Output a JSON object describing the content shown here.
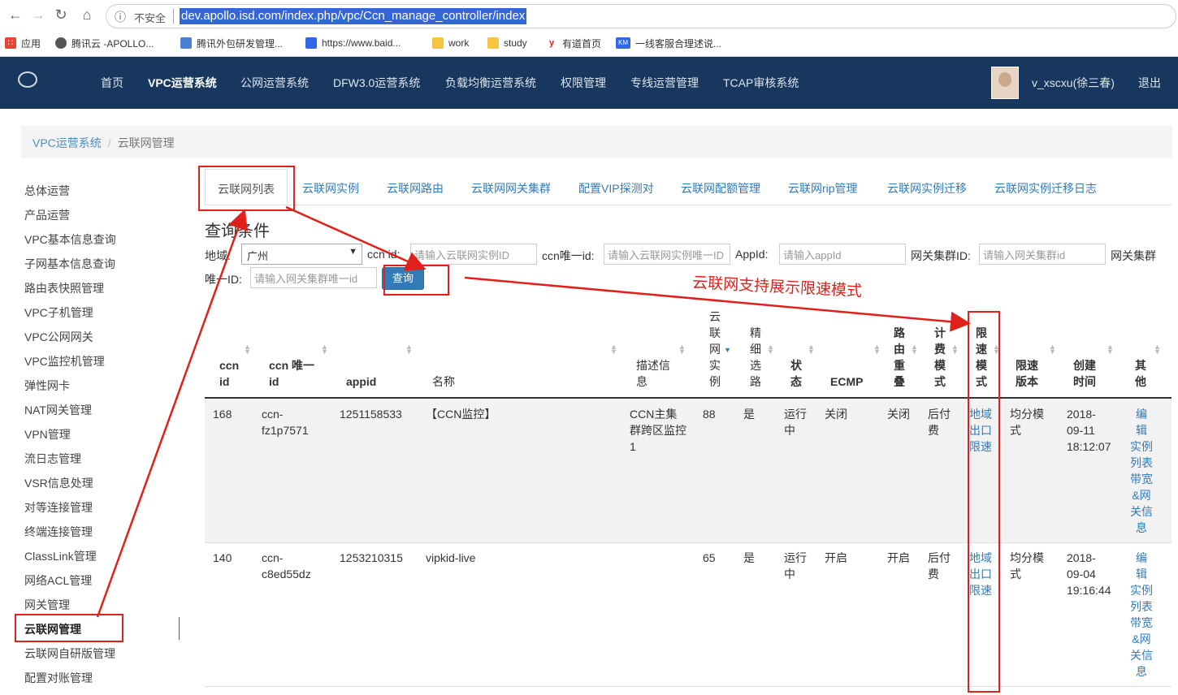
{
  "browser": {
    "security_label": "不安全",
    "url": "dev.apollo.isd.com/index.php/vpc/Ccn_manage_controller/index",
    "bookmarks": [
      {
        "label": "应用"
      },
      {
        "label": "腾讯云 -APOLLO..."
      },
      {
        "label": "腾讯外包研发管理..."
      },
      {
        "label": "https://www.baid..."
      },
      {
        "label": "work"
      },
      {
        "label": "study"
      },
      {
        "label": "有道首页"
      },
      {
        "label": "一线客服合理述说..."
      }
    ]
  },
  "topnav": {
    "items": [
      "首页",
      "VPC运营系统",
      "公网运营系统",
      "DFW3.0运营系统",
      "负载均衡运营系统",
      "权限管理",
      "专线运营管理",
      "TCAP审核系统"
    ],
    "active": "VPC运营系统",
    "user": "v_xscxu(徐三春)",
    "logout": "退出"
  },
  "breadcrumb": [
    "VPC运营系统",
    "云联网管理"
  ],
  "sidebar": {
    "items": [
      "总体运营",
      "产品运营",
      "VPC基本信息查询",
      "子网基本信息查询",
      "路由表快照管理",
      "VPC子机管理",
      "VPC公网网关",
      "VPC监控机管理",
      "弹性网卡",
      "NAT网关管理",
      "VPN管理",
      "流日志管理",
      "VSR信息处理",
      "对等连接管理",
      "终端连接管理",
      "ClassLink管理",
      "网络ACL管理",
      "网关管理",
      "云联网管理",
      "云联网自研版管理",
      "配置对账管理"
    ],
    "active": "云联网管理"
  },
  "tabs": [
    "云联网列表",
    "云联网实例",
    "云联网路由",
    "云联网网关集群",
    "配置VIP探测对",
    "云联网配额管理",
    "云联网rip管理",
    "云联网实例迁移",
    "云联网实例迁移日志"
  ],
  "query": {
    "title": "查询条件",
    "region_label": "地域:",
    "region_value": "广州",
    "ccnid_label": "ccn id:",
    "ccnid_placeholder": "请输入云联网实例ID",
    "uniq_label": "ccn唯一id:",
    "uniq_placeholder": "请输入云联网实例唯一ID",
    "appid_label": "AppId:",
    "appid_placeholder": "请输入appId",
    "gw_label": "网关集群ID:",
    "gw_placeholder": "请输入网关集群id",
    "gwuniq_label1": "网关集群",
    "gwuniq_label2": "唯一ID:",
    "gwuniq_placeholder": "请输入网关集群唯一id",
    "button": "查询"
  },
  "annotation": "云联网支持展示限速模式",
  "table": {
    "headers": {
      "ccnid": [
        "ccn",
        "id"
      ],
      "uniq": [
        "ccn 唯一",
        "id"
      ],
      "appid": [
        "appid"
      ],
      "name": [
        "名称"
      ],
      "desc": [
        "描述信",
        "息"
      ],
      "inst": [
        "云",
        "联",
        "网",
        "实",
        "例"
      ],
      "fine": [
        "精",
        "细",
        "选",
        "路"
      ],
      "state": [
        "状",
        "态"
      ],
      "ecmp": [
        "ECMP"
      ],
      "overlap": [
        "路",
        "由",
        "重",
        "叠"
      ],
      "billing": [
        "计",
        "费",
        "模",
        "式"
      ],
      "limit_mode": [
        "限",
        "速",
        "模",
        "式"
      ],
      "limit_ver": [
        "限速",
        "版本"
      ],
      "ctime": [
        "创建",
        "时间"
      ],
      "other": [
        "其",
        "他"
      ]
    },
    "rows": [
      {
        "ccnid": "168",
        "uniq": [
          "ccn-",
          "fz1p7571"
        ],
        "appid": "1251158533",
        "name": "【CCN监控】",
        "desc": [
          "CCN主集",
          "群跨区监控",
          "1"
        ],
        "inst": "88",
        "fine": "是",
        "state": [
          "运行",
          "中"
        ],
        "ecmp": "关闭",
        "overlap": "关闭",
        "billing": [
          "后付",
          "费"
        ],
        "limit_mode": [
          "地域",
          "出口",
          "限速"
        ],
        "limit_ver": [
          "均分模",
          "式"
        ],
        "ctime": [
          "2018-",
          "09-11",
          "18:12:07"
        ],
        "other": [
          "编",
          "辑",
          "实例",
          "列表",
          "带宽",
          "&网",
          "关信",
          "息"
        ]
      },
      {
        "ccnid": "140",
        "uniq": [
          "ccn-",
          "c8ed55dz"
        ],
        "appid": "1253210315",
        "name": "vipkid-live",
        "desc": [],
        "inst": "65",
        "fine": "是",
        "state": [
          "运行",
          "中"
        ],
        "ecmp": "开启",
        "overlap": "开启",
        "billing": [
          "后付",
          "费"
        ],
        "limit_mode": [
          "地域",
          "出口",
          "限速"
        ],
        "limit_ver": [
          "均分模",
          "式"
        ],
        "ctime": [
          "2018-",
          "09-04",
          "19:16:44"
        ],
        "other": [
          "编",
          "辑",
          "实例",
          "列表",
          "带宽",
          "&网",
          "关信",
          "息"
        ]
      }
    ]
  },
  "colors": {
    "navbar": "#17375e",
    "link": "#337ab7",
    "annotation": "#e0201a",
    "button": "#337ab7"
  }
}
